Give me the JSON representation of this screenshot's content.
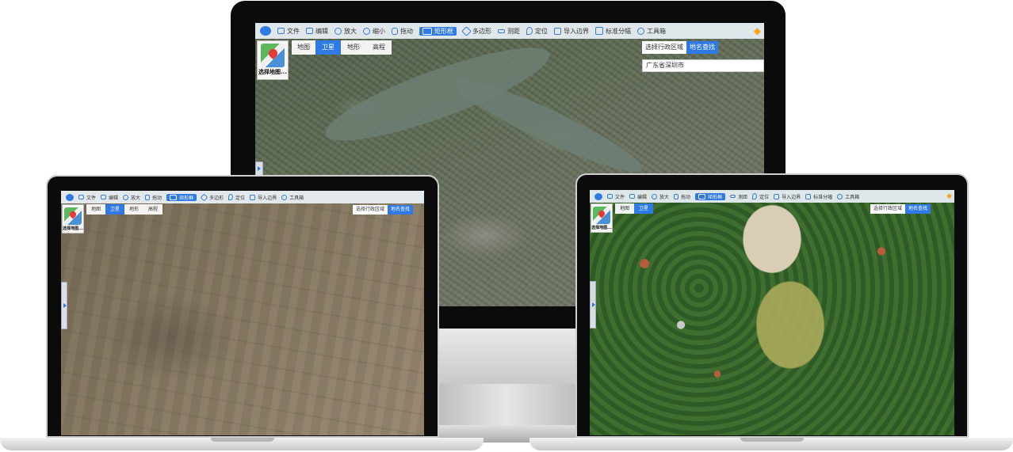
{
  "toolbar": {
    "file": "文件",
    "edit": "编辑",
    "zoom_in": "放大",
    "zoom_out": "缩小",
    "pan": "拖动",
    "rectangle": "矩形框",
    "polygon": "多边形",
    "measure": "测距",
    "locate": "定位",
    "import_boundary": "导入边界",
    "standard_tiles": "标准分幅",
    "toolbox": "工具箱"
  },
  "layer_tabs": [
    "地图",
    "卫星",
    "地形",
    "高程"
  ],
  "select_map": {
    "label": "选择地图..."
  },
  "search": {
    "tab_admin": "选择行政区域",
    "tab_place": "地名查找",
    "value": "广东省深圳市"
  },
  "icons": {
    "logo": "app-logo-icon",
    "rectangle": "rectangle-select-icon",
    "polygon": "polygon-icon",
    "locate": "location-pin-icon",
    "grid": "grid-icon",
    "toolbox": "gear-icon",
    "select_map": "map-icon",
    "vip": "diamond-icon"
  },
  "colors": {
    "accent": "#2f7ae5",
    "toolbar": "#ebf1f8"
  }
}
